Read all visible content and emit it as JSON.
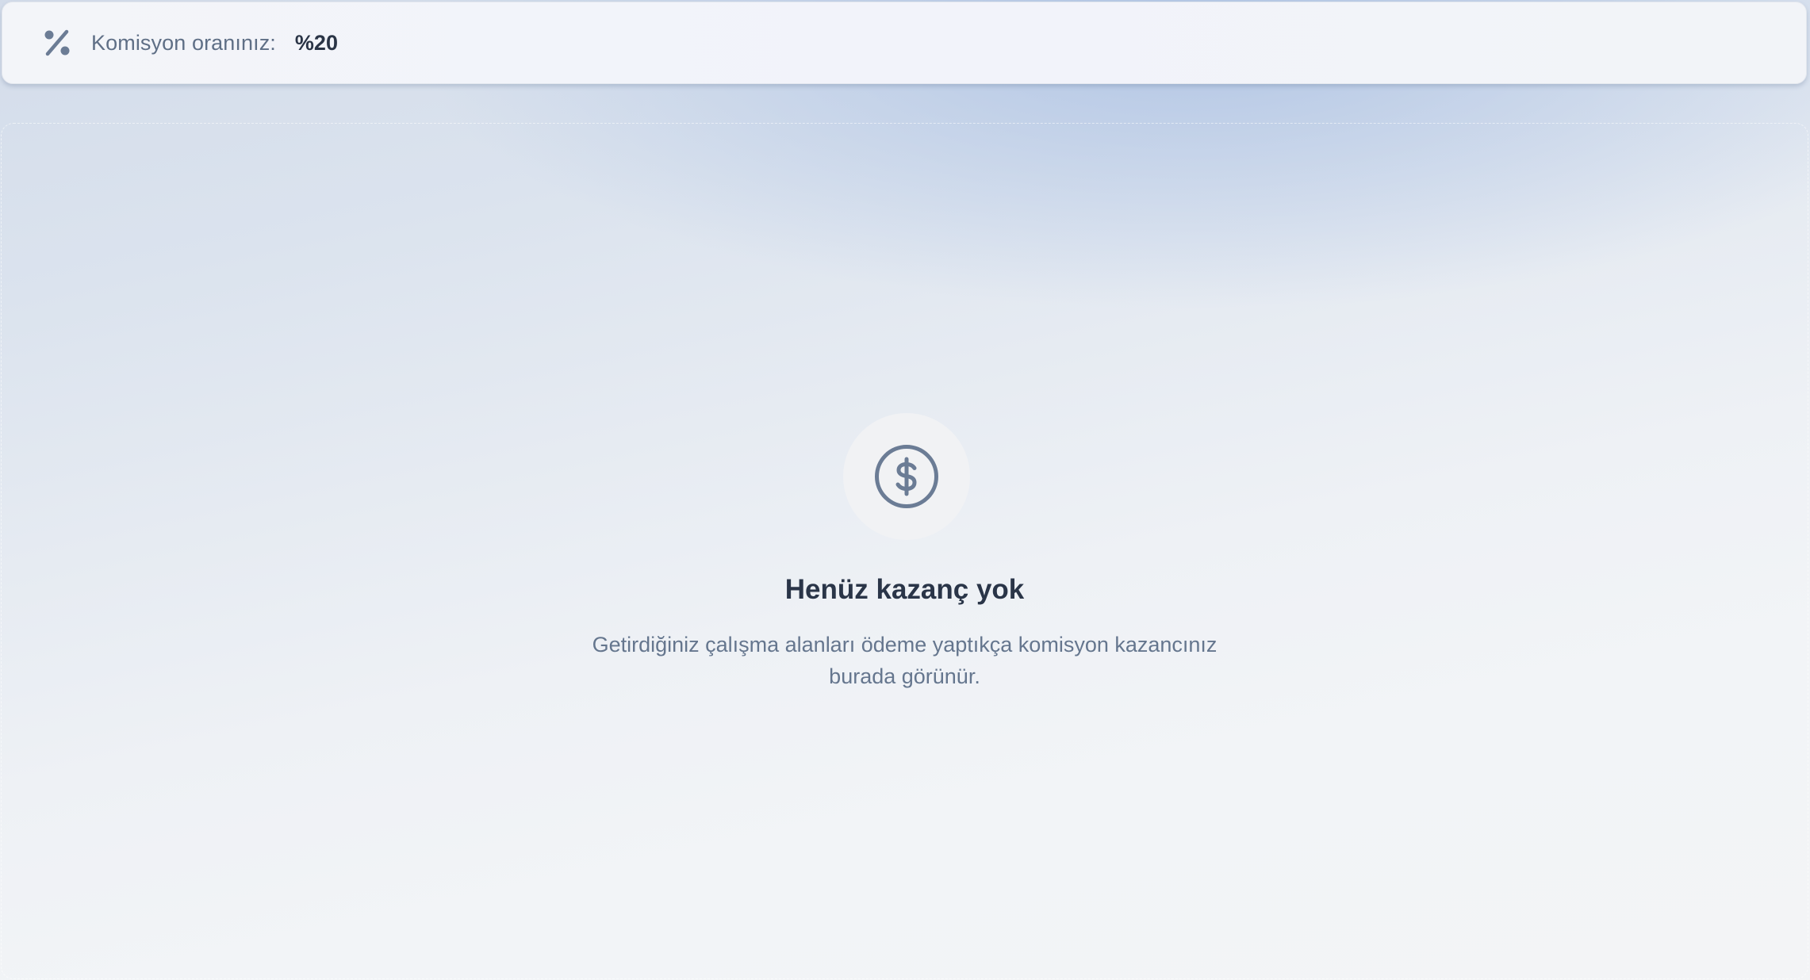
{
  "commission": {
    "icon": "percent-icon",
    "label": "Komisyon oranınız:",
    "value": "%20"
  },
  "empty_state": {
    "icon": "dollar-circle-icon",
    "title": "Henüz kazanç yok",
    "description": "Getirdiğiniz çalışma alanları ödeme yaptıkça komisyon kazancınız burada görünür."
  },
  "colors": {
    "icon": "#6b7c95",
    "title": "#2a3548",
    "text_muted": "#65768e"
  }
}
